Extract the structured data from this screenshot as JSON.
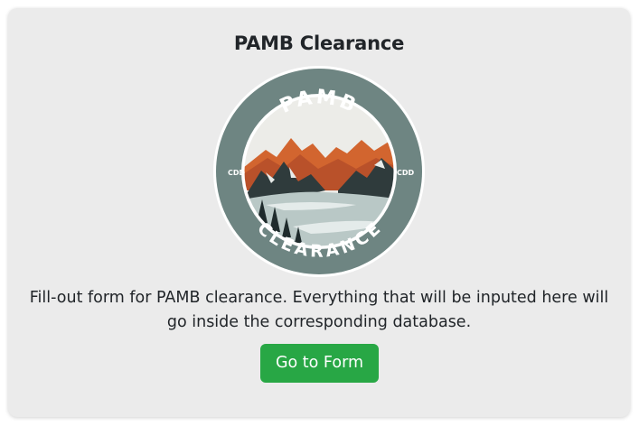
{
  "card": {
    "title": "PAMB Clearance",
    "description": "Fill-out form for PAMB clearance. Everything that will be inputed here will go inside the corresponding database.",
    "button_label": "Go to Form"
  },
  "logo": {
    "top_text": "PAMB",
    "bottom_text": "CLEARANCE",
    "left_text": "CDD",
    "right_text": "CDD"
  },
  "colors": {
    "card_bg": "#ebebeb",
    "button_bg": "#28a745",
    "ring": "#6e8582",
    "mountain_orange": "#d2652f"
  }
}
